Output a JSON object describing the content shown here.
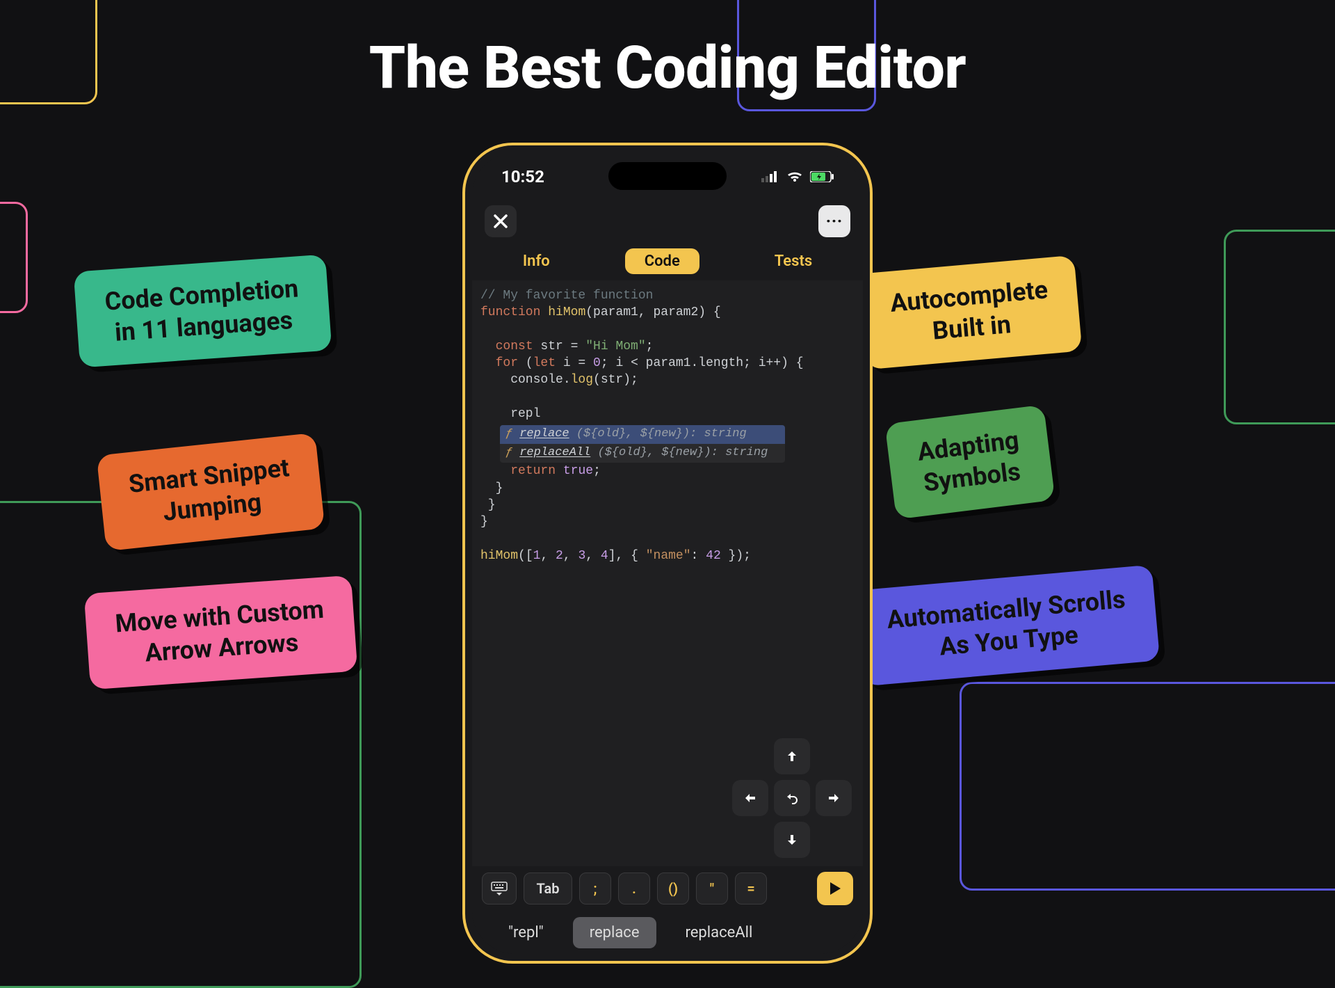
{
  "headline": "The Best Coding Editor",
  "callouts": {
    "left": [
      "Code Completion\nin 11 languages",
      "Smart Snippet\nJumping",
      "Move with Custom\nArrow Arrows"
    ],
    "right": [
      "Autocomplete\nBuilt in",
      "Adapting\nSymbols",
      "Automatically Scrolls\nAs You Type"
    ]
  },
  "phone": {
    "status_time": "10:52",
    "topbar": {
      "close": "✕",
      "more": "···"
    },
    "tabs": {
      "info": "Info",
      "code": "Code",
      "tests": "Tests"
    },
    "code": {
      "l1_comment": "// My favorite function",
      "l2_kw": "function",
      "l2_fn": "hiMom",
      "l2_rest": "(param1, param2) {",
      "l3_kw": "const",
      "l3_mid": " str = ",
      "l3_str": "\"Hi Mom\"",
      "l3_end": ";",
      "l4_for": "for",
      "l4_paren": " (",
      "l4_let": "let",
      "l4_init": " i = ",
      "l4_zero": "0",
      "l4_mid": "; i < param1.length; i++) {",
      "l5_a": "    console.",
      "l5_log": "log",
      "l5_b": "(str);",
      "l6_partial": "    repl",
      "l7_kw": "return",
      "l7_sp": " ",
      "l7_true": "true",
      "l7_end": ";",
      "l10_fn": "hiMom",
      "l10_a": "([",
      "l10_n1": "1",
      "l10_c": ", ",
      "l10_n2": "2",
      "l10_n3": "3",
      "l10_n4": "4",
      "l10_b": "], { ",
      "l10_key": "\"name\"",
      "l10_colon": ": ",
      "l10_val": "42",
      "l10_end": " });"
    },
    "autocomplete": {
      "kind": "ƒ",
      "items": [
        {
          "name": "replace",
          "sig": "(${old}, ${new}): string",
          "selected": true
        },
        {
          "name": "replaceAll",
          "sig": "(${old}, ${new}): string",
          "selected": false
        }
      ]
    },
    "symbol_keys": {
      "tab": "Tab",
      "semi": ";",
      "dot": ".",
      "paren": "()",
      "quote": "\"",
      "eq": "="
    },
    "suggestions": {
      "s1": "\"repl\"",
      "s2": "replace",
      "s3": "replaceAll"
    }
  }
}
